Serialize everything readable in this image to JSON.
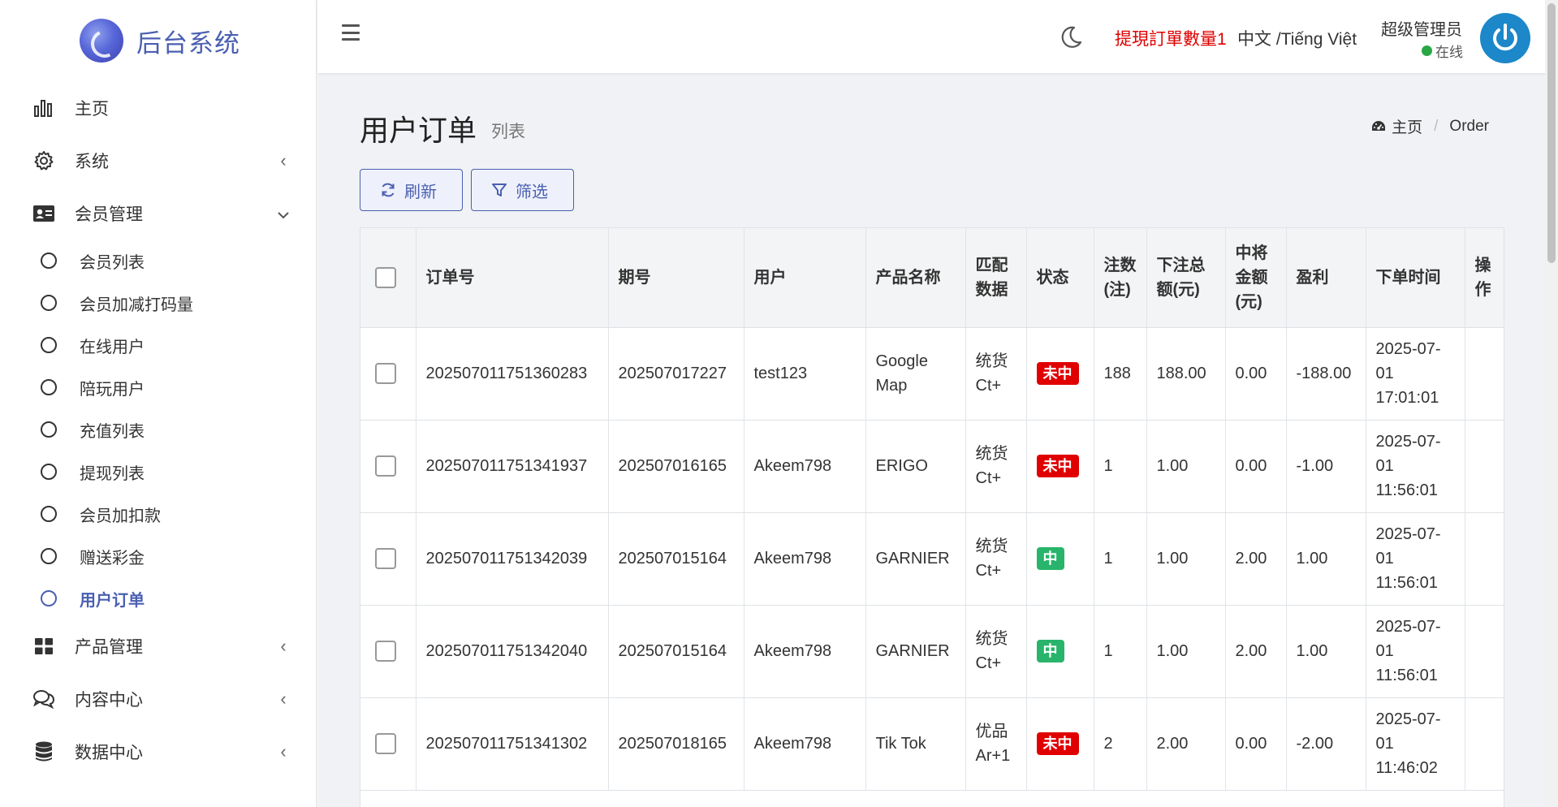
{
  "brand": {
    "name": "后台系统"
  },
  "sidebar": {
    "items": [
      {
        "label": "主页",
        "icon": "bar-chart-icon"
      },
      {
        "label": "系统",
        "icon": "gear-icon",
        "arrow": "‹"
      },
      {
        "label": "会员管理",
        "icon": "id-card-icon",
        "arrow": "⌄"
      }
    ],
    "sub_items": [
      {
        "label": "会员列表"
      },
      {
        "label": "会员加减打码量"
      },
      {
        "label": "在线用户"
      },
      {
        "label": "陪玩用户"
      },
      {
        "label": "充值列表"
      },
      {
        "label": "提现列表"
      },
      {
        "label": "会员加扣款"
      },
      {
        "label": "赠送彩金"
      },
      {
        "label": "用户订单"
      }
    ],
    "bottom_items": [
      {
        "label": "产品管理",
        "icon": "grid-icon",
        "arrow": "‹"
      },
      {
        "label": "内容中心",
        "icon": "comments-icon",
        "arrow": "‹"
      },
      {
        "label": "数据中心",
        "icon": "database-icon",
        "arrow": "‹"
      }
    ]
  },
  "header": {
    "notice": "提現訂單數量1",
    "lang": "中文 /Tiếng Việt",
    "user_name": "超级管理员",
    "user_status": "在线"
  },
  "page": {
    "title": "用户订单",
    "subtitle": "列表",
    "breadcrumb_home": "主页",
    "breadcrumb_current": "Order",
    "refresh_label": "刷新",
    "filter_label": "筛选"
  },
  "table": {
    "headers": [
      "订单号",
      "期号",
      "用户",
      "产品名称",
      "匹配数据",
      "状态",
      "注数(注)",
      "下注总额(元)",
      "中将金额(元)",
      "盈利",
      "下单时间",
      "操作"
    ],
    "rows": [
      {
        "order": "202507011751360283",
        "period": "202507017227",
        "user": "test123",
        "product": "Google Map",
        "match": "统货Ct+",
        "status": "未中",
        "win": false,
        "count": "188",
        "bet": "188.00",
        "prize": "0.00",
        "profit": "-188.00",
        "time": "2025-07-01 17:01:01"
      },
      {
        "order": "202507011751341937",
        "period": "202507016165",
        "user": "Akeem798",
        "product": "ERIGO",
        "match": "统货Ct+",
        "status": "未中",
        "win": false,
        "count": "1",
        "bet": "1.00",
        "prize": "0.00",
        "profit": "-1.00",
        "time": "2025-07-01 11:56:01"
      },
      {
        "order": "202507011751342039",
        "period": "202507015164",
        "user": "Akeem798",
        "product": "GARNIER",
        "match": "统货Ct+",
        "status": "中",
        "win": true,
        "count": "1",
        "bet": "1.00",
        "prize": "2.00",
        "profit": "1.00",
        "time": "2025-07-01 11:56:01"
      },
      {
        "order": "202507011751342040",
        "period": "202507015164",
        "user": "Akeem798",
        "product": "GARNIER",
        "match": "统货Ct+",
        "status": "中",
        "win": true,
        "count": "1",
        "bet": "1.00",
        "prize": "2.00",
        "profit": "1.00",
        "time": "2025-07-01 11:56:01"
      },
      {
        "order": "202507011751341302",
        "period": "202507018165",
        "user": "Akeem798",
        "product": "Tik Tok",
        "match": "优品Ar+1",
        "status": "未中",
        "win": false,
        "count": "2",
        "bet": "2.00",
        "prize": "0.00",
        "profit": "-2.00",
        "time": "2025-07-01 11:46:02"
      }
    ]
  },
  "colors": {
    "accent": "#4a5fb1",
    "lose": "#e00000",
    "win": "#28b46b",
    "online": "#28a745"
  }
}
